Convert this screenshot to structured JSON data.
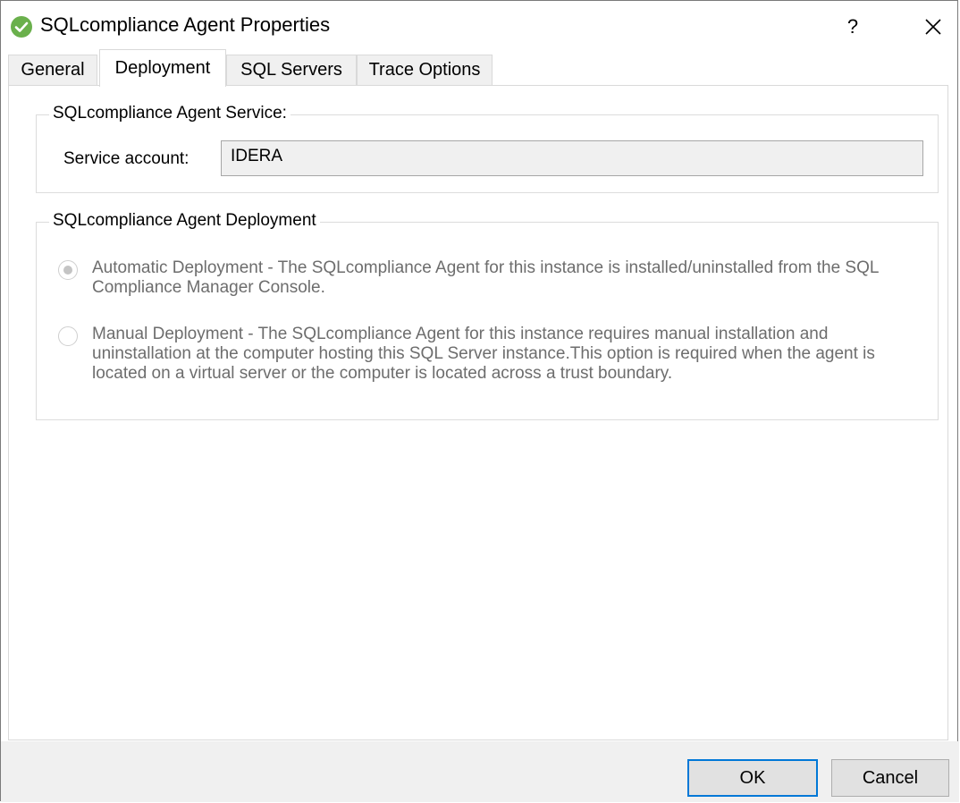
{
  "window": {
    "title": "SQLcompliance Agent Properties",
    "help_label": "?",
    "close_icon": "close-icon",
    "app_icon": "check-circle-icon",
    "app_icon_color": "#6ab04c"
  },
  "tabs": [
    {
      "label": "General"
    },
    {
      "label": "Deployment",
      "active": true
    },
    {
      "label": "SQL Servers"
    },
    {
      "label": "Trace Options"
    }
  ],
  "service_group": {
    "legend": "SQLcompliance Agent Service:",
    "account_label": "Service account:",
    "account_value": "IDERA"
  },
  "deployment_group": {
    "legend": "SQLcompliance Agent Deployment",
    "options": [
      {
        "label": "Automatic Deployment - The SQLcompliance Agent for this instance is installed/uninstalled from the SQL Compliance Manager Console.",
        "checked": true,
        "enabled": false
      },
      {
        "label": "Manual Deployment - The SQLcompliance Agent for this instance requires manual installation and uninstallation at the computer hosting this SQL Server instance.This option is required when the agent is located on a virtual server or the computer is located across a trust boundary.",
        "checked": false,
        "enabled": false
      }
    ]
  },
  "footer": {
    "ok_label": "OK",
    "cancel_label": "Cancel"
  }
}
